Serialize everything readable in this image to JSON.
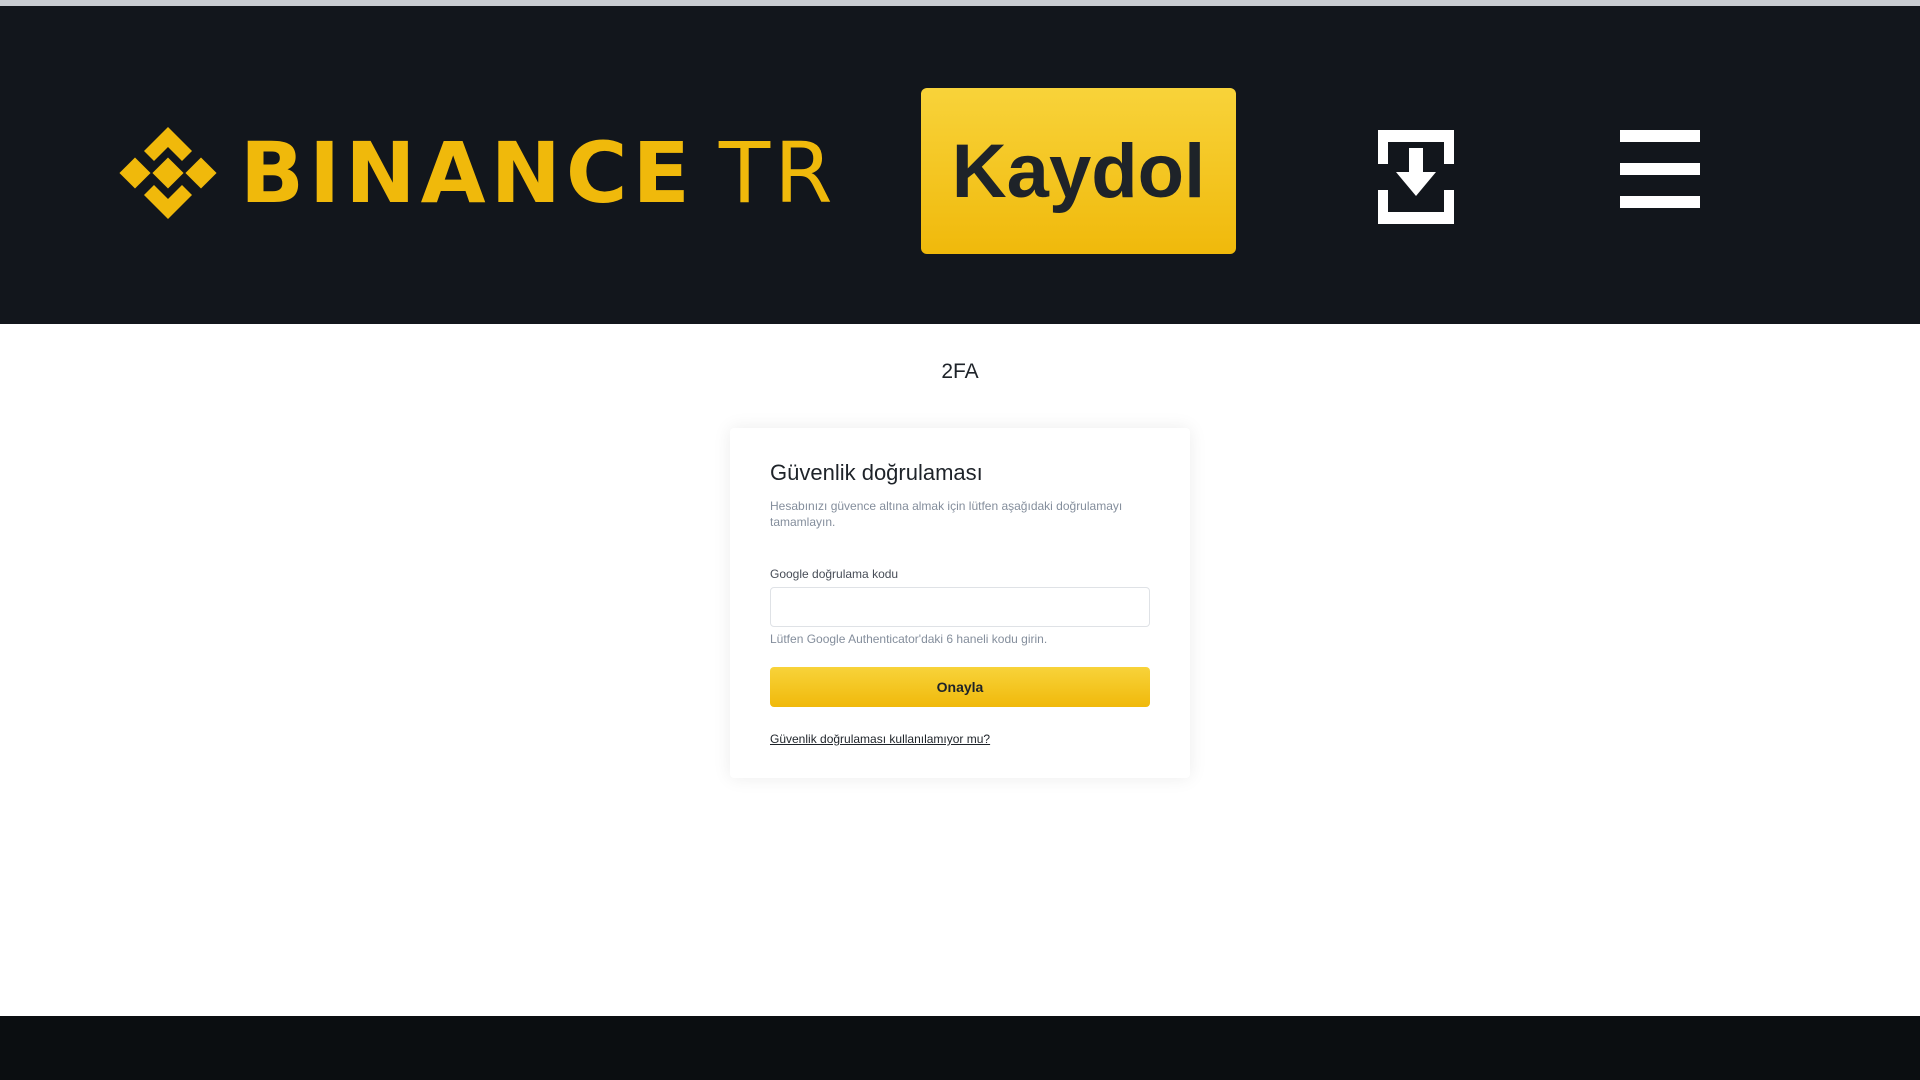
{
  "colors": {
    "brand": "#f0b90b",
    "header_bg": "#12161c",
    "footer_bg": "#0b0e11",
    "text_primary": "#1e2329",
    "text_secondary": "#848e9c"
  },
  "header": {
    "logo_icon": "binance-diamond-logo",
    "logo_name": "BINANCE",
    "logo_suffix": "TR",
    "signup_label": "Kaydol",
    "download_icon": "download-icon",
    "menu_icon": "hamburger-menu-icon"
  },
  "page": {
    "title": "2FA"
  },
  "card": {
    "title": "Güvenlik doğrulaması",
    "description": "Hesabınızı güvence altına almak için lütfen aşağıdaki doğrulamayı tamamlayın.",
    "field_label": "Google doğrulama kodu",
    "field_value": "",
    "field_hint": "Lütfen Google Authenticator'daki 6 haneli kodu girin.",
    "confirm_label": "Onayla",
    "alt_link": "Güvenlik doğrulaması kullanılamıyor mu?"
  }
}
